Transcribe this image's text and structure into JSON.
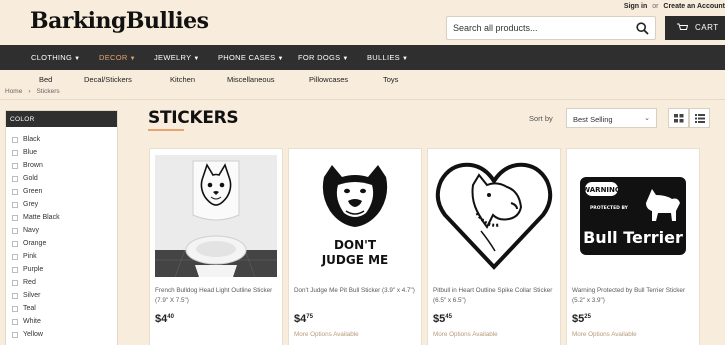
{
  "header": {
    "logo_text": "BarkingBullies",
    "sign_in": "Sign in",
    "or": "or",
    "create_account": "Create an Account",
    "search_placeholder": "Search all products...",
    "cart_label": "CART"
  },
  "main_nav": [
    {
      "label": "CLOTHING",
      "active": false
    },
    {
      "label": "DECOR",
      "active": true
    },
    {
      "label": "JEWELRY",
      "active": false
    },
    {
      "label": "PHONE CASES",
      "active": false
    },
    {
      "label": "FOR DOGS",
      "active": false
    },
    {
      "label": "BULLIES",
      "active": false
    }
  ],
  "sub_nav": [
    "Bed",
    "Decal/Stickers",
    "Kitchen",
    "Miscellaneous",
    "Pillowcases",
    "Toys"
  ],
  "breadcrumb": {
    "home": "Home",
    "sep": "›",
    "current": "Stickers"
  },
  "sidebar": {
    "heading": "COLOR",
    "colors": [
      "Black",
      "Blue",
      "Brown",
      "Gold",
      "Green",
      "Grey",
      "Matte Black",
      "Navy",
      "Orange",
      "Pink",
      "Purple",
      "Red",
      "Silver",
      "Teal",
      "White",
      "Yellow"
    ]
  },
  "page": {
    "title": "STICKERS",
    "sort_label": "Sort by",
    "sort_value": "Best Selling",
    "accent_color": "#e7a46f"
  },
  "products": [
    {
      "name": "French Bulldog Head Light Outline Sticker (7.9\" X 7.5\")",
      "price_main": "$4",
      "price_cents": "40",
      "more": ""
    },
    {
      "name": "Don't Judge Me Pit Bull Sticker (3.9\" x 4.7\")",
      "price_main": "$4",
      "price_cents": "75",
      "more": "More Options Available",
      "image_text_1": "DON'T",
      "image_text_2": "JUDGE ME"
    },
    {
      "name": "Pitbull in Heart Outline Spike Collar Sticker (6.5\" x 6.5\")",
      "price_main": "$5",
      "price_cents": "45",
      "more": "More Options Available"
    },
    {
      "name": "Warning Protected by Bull Terrier Sticker (5.2\" x 3.9\")",
      "price_main": "$5",
      "price_cents": "25",
      "more": "More Options Available",
      "image_text_1": "WARNING",
      "image_text_2": "PROTECTED BY",
      "image_text_3": "Bull Terrier"
    }
  ]
}
